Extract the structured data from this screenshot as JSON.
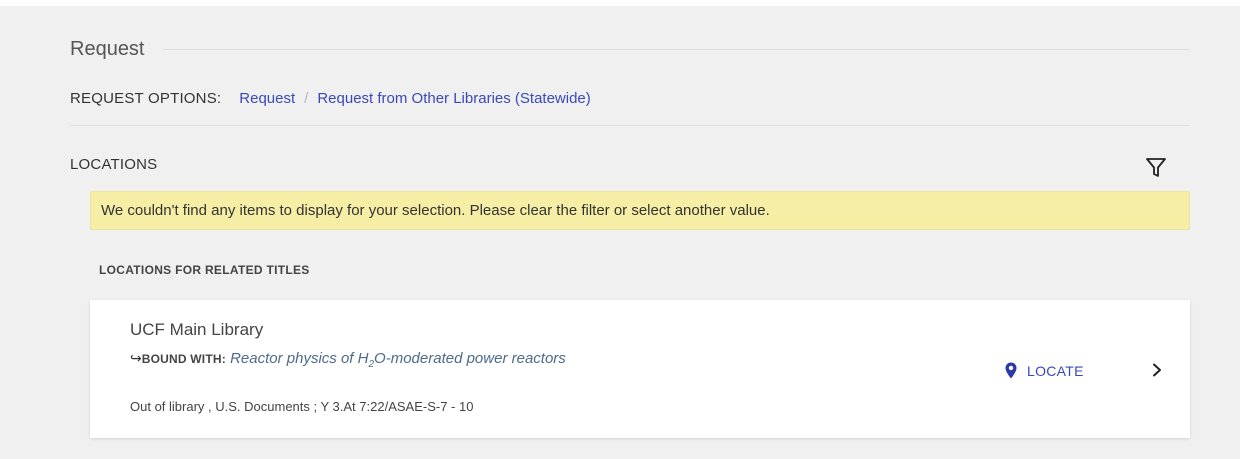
{
  "section": {
    "title": "Request"
  },
  "request_options": {
    "label": "REQUEST OPTIONS:",
    "links": [
      {
        "label": "Request"
      },
      {
        "label": "Request from Other Libraries (Statewide)"
      }
    ],
    "separator": "/"
  },
  "locations": {
    "label": "LOCATIONS",
    "filter_icon": "filter-icon",
    "notice": "We couldn't find any items to display for your selection. Please clear the filter or select another value.",
    "related_label": "LOCATIONS FOR RELATED TITLES",
    "items": [
      {
        "library": "UCF Main Library",
        "bound_arrow": "↪",
        "bound_label": "BOUND WITH:",
        "bound_title_prefix": "Reactor physics of H",
        "bound_title_sub": "2",
        "bound_title_suffix": "O-moderated power reactors",
        "holding": "Out of library , U.S. Documents ; Y 3.At 7:22/ASAE-S-7 - 10",
        "locate_label": "LOCATE",
        "locate_icon": "map-pin-icon",
        "chevron_icon": "chevron-right-icon"
      }
    ]
  },
  "colors": {
    "link": "#3a49b8",
    "notice_bg": "#f7eea5",
    "panel_bg": "#f0f0f0",
    "bound_title": "#4d6b8a"
  }
}
